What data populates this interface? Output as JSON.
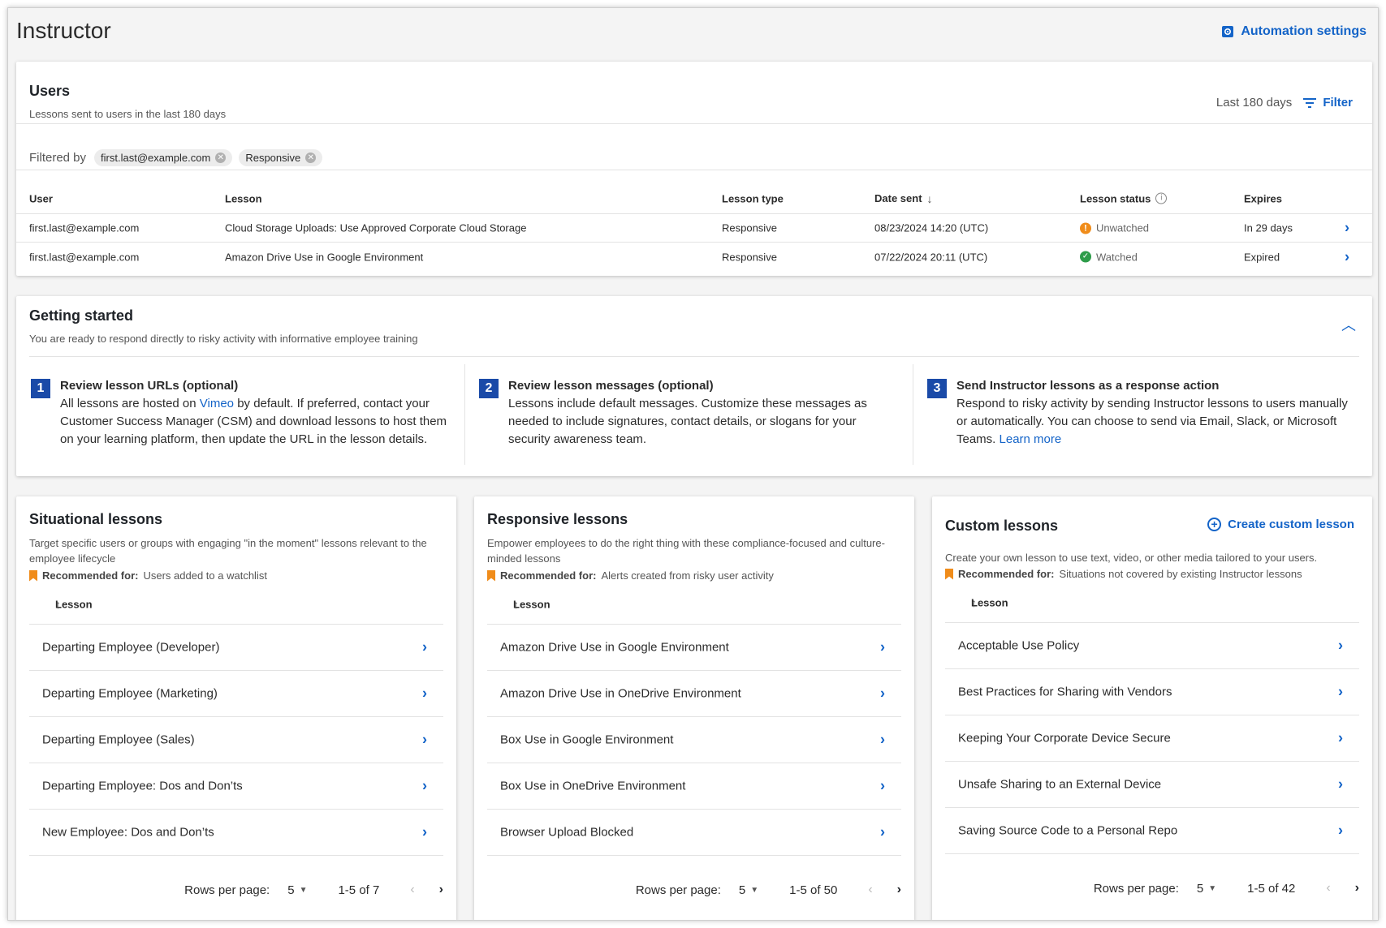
{
  "header": {
    "title": "Instructor",
    "automation_label": "Automation settings"
  },
  "users": {
    "title": "Users",
    "subtitle": "Lessons sent to users in the last 180 days",
    "range": "Last 180 days",
    "filter_label": "Filter",
    "filtered_by_label": "Filtered by",
    "chips": [
      "first.last@example.com",
      "Responsive"
    ],
    "columns": [
      "User",
      "Lesson",
      "Lesson type",
      "Date sent",
      "Lesson status",
      "Expires"
    ],
    "rows": [
      {
        "user": "first.last@example.com",
        "lesson": "Cloud Storage Uploads: Use Approved Corporate Cloud Storage",
        "type": "Responsive",
        "date": "08/23/2024 14:20 (UTC)",
        "status": "Unwatched",
        "expires": "In 29 days"
      },
      {
        "user": "first.last@example.com",
        "lesson": "Amazon Drive Use in Google Environment",
        "type": "Responsive",
        "date": "07/22/2024 20:11 (UTC)",
        "status": "Watched",
        "expires": "Expired"
      }
    ]
  },
  "getting_started": {
    "title": "Getting started",
    "subtitle": "You are ready to respond directly to risky activity with informative employee training",
    "steps": [
      {
        "num": "1",
        "title": "Review lesson URLs (optional)",
        "text_a": "All lessons are hosted on ",
        "link": "Vimeo",
        "text_b": " by default. If preferred, contact your Customer Success Manager (CSM) and download lessons to host them on your learning platform, then update the URL in the lesson details."
      },
      {
        "num": "2",
        "title": "Review lesson messages (optional)",
        "text_a": "Lessons include default messages. Customize these messages as needed to include signatures, contact details, or slogans for your security awareness team.",
        "link": "",
        "text_b": ""
      },
      {
        "num": "3",
        "title": "Send Instructor lessons as a response action",
        "text_a": "Respond to risky activity by sending Instructor lessons to users manually or automatically. You can choose to send via Email, Slack, or Microsoft Teams. ",
        "link": "Learn more",
        "text_b": ""
      }
    ]
  },
  "situational": {
    "title": "Situational lessons",
    "description": "Target specific users or groups with engaging \"in the moment\" lessons relevant to the employee lifecycle",
    "rec_label": "Recommended for:",
    "rec_value": "Users added to a watchlist",
    "column": "Lesson",
    "items": [
      "Departing Employee (Developer)",
      "Departing Employee (Marketing)",
      "Departing Employee (Sales)",
      "Departing Employee: Dos and Don’ts",
      "New Employee: Dos and Don’ts"
    ],
    "rows_label": "Rows per page:",
    "rows_value": "5",
    "count": "1-5 of 7"
  },
  "responsive": {
    "title": "Responsive lessons",
    "description": "Empower employees to do the right thing with these compliance-focused and culture-minded lessons",
    "rec_label": "Recommended for:",
    "rec_value": "Alerts created from risky user activity",
    "column": "Lesson",
    "items": [
      "Amazon Drive Use in Google Environment",
      "Amazon Drive Use in OneDrive Environment",
      "Box Use in Google Environment",
      "Box Use in OneDrive Environment",
      "Browser Upload Blocked"
    ],
    "rows_label": "Rows per page:",
    "rows_value": "5",
    "count": "1-5 of 50"
  },
  "custom": {
    "title": "Custom lessons",
    "create_label": "Create custom lesson",
    "description": "Create your own lesson to use text, video, or other media tailored to your users.",
    "rec_label": "Recommended for:",
    "rec_value": "Situations not covered by existing Instructor lessons",
    "column": "Lesson",
    "items": [
      "Acceptable Use Policy",
      "Best Practices for Sharing with Vendors",
      "Keeping Your Corporate Device Secure",
      "Unsafe Sharing to an External Device",
      "Saving Source Code to a Personal Repo"
    ],
    "rows_label": "Rows per page:",
    "rows_value": "5",
    "count": "1-5 of 42"
  },
  "colors": {
    "accent": "#1464c8",
    "warning": "#f08c1a",
    "success": "#2e9c4a",
    "step_badge": "#1a4aa8"
  }
}
